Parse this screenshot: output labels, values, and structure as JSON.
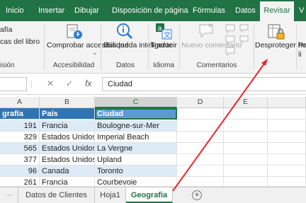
{
  "ribbon_tabs": [
    "Inicio",
    "Insertar",
    "Dibujar",
    "Disposición de página",
    "Fórmulas",
    "Datos",
    "Revisar",
    "V"
  ],
  "ribbon": {
    "left_fragments": [
      "afía",
      "cas del libro",
      "isión"
    ],
    "check_accessibility": "Comprobar accesibilidad",
    "check_accessibility_chevron": "⌄",
    "accessibility_group": "Accesibilidad",
    "smart_lookup": "Búsqueda inteligente",
    "data_group": "Datos",
    "translate": "Traducir",
    "language_group": "Idioma",
    "new_comment": "Nuevo comentario",
    "comments_group": "Comentarios",
    "unprotect_sheet": "Desproteger hoja",
    "protect_fragment": "Pro li"
  },
  "formula_bar": {
    "cancel": "✕",
    "enter": "✓",
    "fx": "fx",
    "content": "Ciudad"
  },
  "grid": {
    "columns": [
      "A",
      "B",
      "C",
      "D",
      "E"
    ],
    "selected_column": "C",
    "header": [
      "grafía",
      "País",
      "Ciudad"
    ],
    "rows": [
      [
        "191",
        "Francia",
        "Boulogne-sur-Mer"
      ],
      [
        "329",
        "Estados Unidos",
        "Imperial Beach"
      ],
      [
        "565",
        "Estados Unidos",
        "La Vergne"
      ],
      [
        "377",
        "Estados Unidos",
        "Upland"
      ],
      [
        "96",
        "Canada",
        "Toronto"
      ],
      [
        "261",
        "Francia",
        "Courbevoie"
      ]
    ]
  },
  "sheet_tabs": [
    "Datos de Clientes",
    "Hoja1",
    "Geografia"
  ],
  "active_sheet": "Geografia",
  "add_sheet": "+",
  "colors": {
    "ribbon_green": "#217346",
    "table_header": "#2f75b5",
    "band": "#ddebf7",
    "arrow": "#e8262e"
  }
}
